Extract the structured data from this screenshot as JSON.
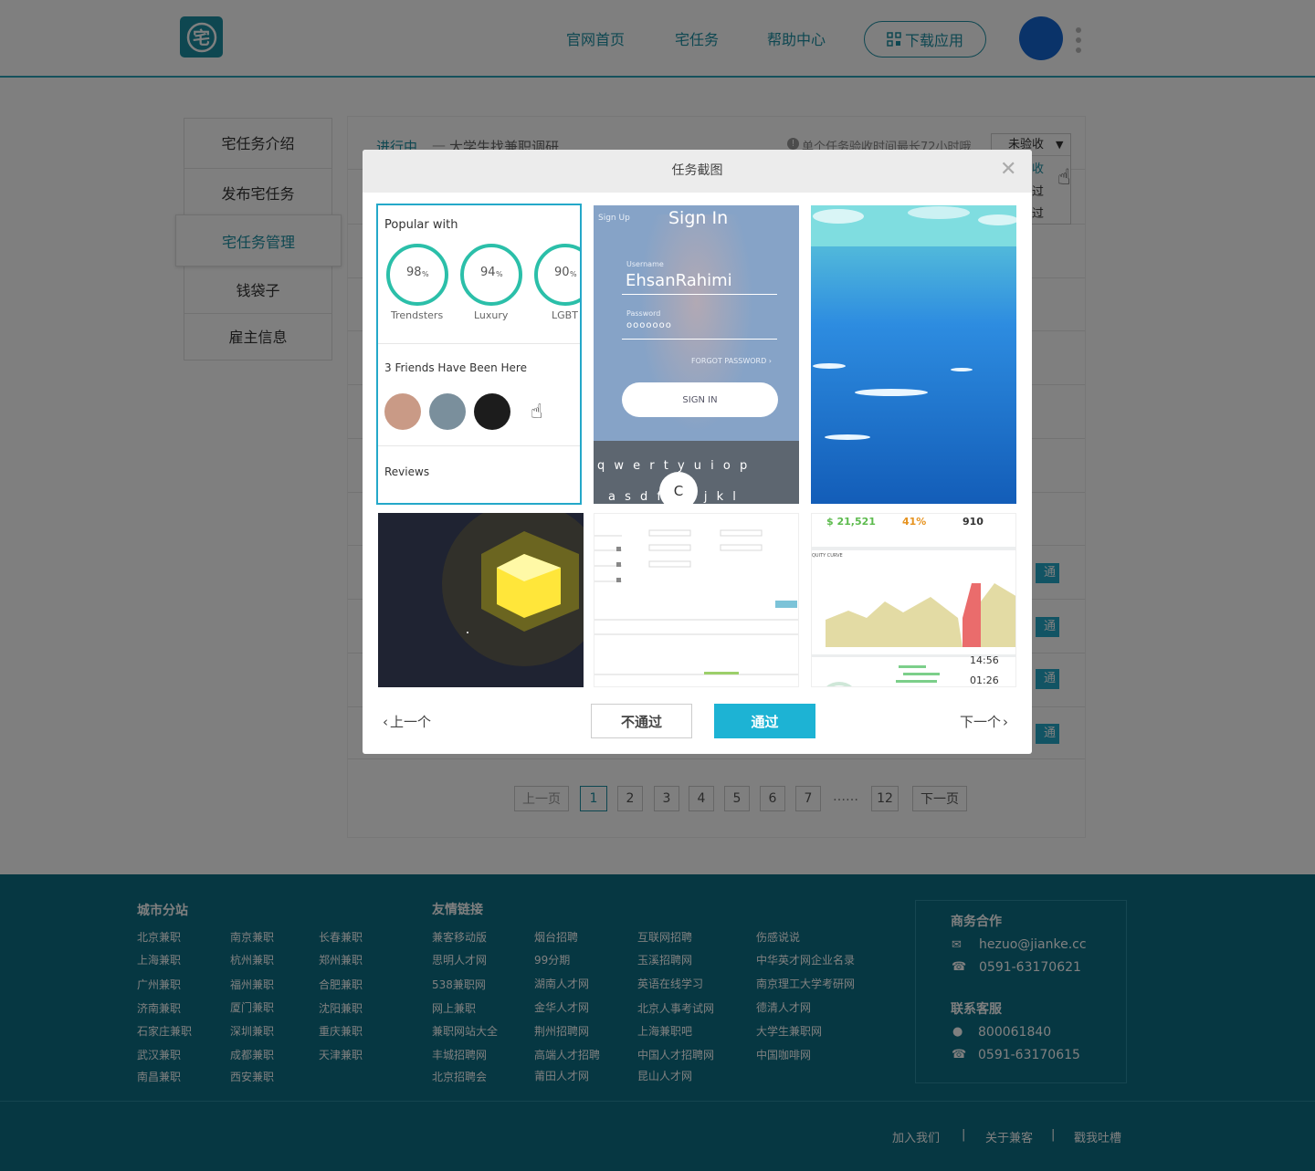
{
  "header": {
    "logo_glyph": "宅",
    "nav": [
      "官网首页",
      "宅任务",
      "帮助中心"
    ],
    "download_label": "下载应用"
  },
  "sidebar": {
    "items": [
      "宅任务介绍",
      "发布宅任务",
      "宅任务管理",
      "钱袋子",
      "雇主信息"
    ],
    "active_index": 2
  },
  "task_panel": {
    "status_label": "进行中",
    "separator": "—",
    "task_title": "大学生找兼职调研",
    "notice": "单个任务验收时间最长72小时哦",
    "filter_value": "未验收",
    "filter_options": [
      "未验收",
      "已通过",
      "未通过"
    ],
    "row_action": "通过"
  },
  "pagination": {
    "prev": "上一页",
    "pages": [
      "1",
      "2",
      "3",
      "4",
      "5",
      "6",
      "7"
    ],
    "ellipsis": "……",
    "last": "12",
    "next": "下一页",
    "current": "1"
  },
  "modal": {
    "title": "任务截图",
    "close_icon": "close-icon",
    "prev_label": "上一个",
    "next_label": "下一个",
    "reject_label": "不通过",
    "approve_label": "通过",
    "thumb1": {
      "heading": "Popular with",
      "stats": [
        {
          "value": "98",
          "unit": "%",
          "label": "Trendsters"
        },
        {
          "value": "94",
          "unit": "%",
          "label": "Luxury"
        },
        {
          "value": "90",
          "unit": "%",
          "label": "LGBT"
        }
      ],
      "friends": "3 Friends Have Been Here",
      "reviews": "Reviews"
    },
    "thumb2": {
      "back": "Sign Up",
      "title": "Sign In",
      "user_label": "Username",
      "user_value": "EhsanRahimi",
      "pass_label": "Password",
      "pass_value": "ooooooo",
      "forgot": "FORGOT PASSWORD ›",
      "button": "SIGN IN",
      "keys1": "q w e r t y u i o p",
      "keys2": "a s d f g h j k l",
      "key_popup": "C"
    },
    "thumb6": {
      "metric1": "$ 21,521",
      "metric2": "41%",
      "metric3": "910",
      "curve_label": "QUITY CURVE",
      "time1": "14:56",
      "time2": "01:26"
    }
  },
  "footer": {
    "cities_title": "城市分站",
    "cities": [
      [
        "北京兼职",
        "上海兼职",
        "广州兼职",
        "济南兼职",
        "石家庄兼职",
        "武汉兼职",
        "南昌兼职"
      ],
      [
        "南京兼职",
        "杭州兼职",
        "福州兼职",
        "厦门兼职",
        "深圳兼职",
        "成都兼职",
        "西安兼职"
      ],
      [
        "长春兼职",
        "郑州兼职",
        "合肥兼职",
        "沈阳兼职",
        "重庆兼职",
        "天津兼职"
      ]
    ],
    "links_title": "友情链接",
    "links": [
      [
        "兼客移动版",
        "思明人才网",
        "538兼职网",
        "网上兼职",
        "兼职网站大全",
        "丰城招聘网",
        "北京招聘会"
      ],
      [
        "烟台招聘",
        "99分期",
        "湖南人才网",
        "金华人才网",
        "荆州招聘网",
        "高端人才招聘",
        "莆田人才网"
      ],
      [
        "互联网招聘",
        "玉溪招聘网",
        "英语在线学习",
        "北京人事考试网",
        "上海兼职吧",
        "中国人才招聘网",
        "昆山人才网"
      ],
      [
        "伤感说说",
        "中华英才网企业名录",
        "南京理工大学考研网",
        "德清人才网",
        "大学生兼职网",
        "中国咖啡网"
      ]
    ],
    "biz_title": "商务合作",
    "email": "hezuo@jianke.cc",
    "biz_phone": "0591-63170621",
    "service_title": "联系客服",
    "qq": "800061840",
    "service_phone": "0591-63170615",
    "bottom": [
      "加入我们",
      "关于兼客",
      "戳我吐槽"
    ],
    "divider": "|"
  },
  "colors": {
    "brand": "#1d8fa3",
    "approve": "#1db3d4",
    "footer": "#0d6e85"
  }
}
